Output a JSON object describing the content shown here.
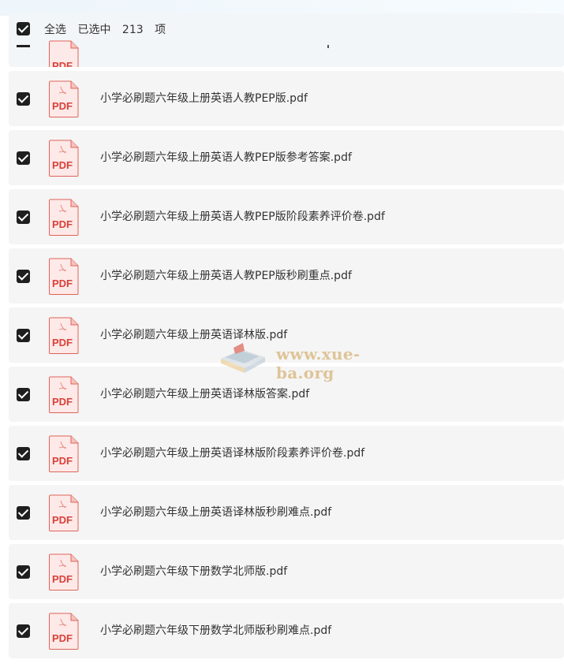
{
  "header": {
    "select_all_label": "全选",
    "selected_prefix": "已选中",
    "selected_count": "213",
    "selected_suffix": "项"
  },
  "file_icon_label": "PDF",
  "watermark_text": "www.xue-ba.org",
  "files": [
    {
      "name": "小学必刷题六年级上册英语人教PEP版.pdf",
      "checked": true
    },
    {
      "name": "小学必刷题六年级上册英语人教PEP版参考答案.pdf",
      "checked": true
    },
    {
      "name": "小学必刷题六年级上册英语人教PEP版阶段素养评价卷.pdf",
      "checked": true
    },
    {
      "name": "小学必刷题六年级上册英语人教PEP版秒刷重点.pdf",
      "checked": true
    },
    {
      "name": "小学必刷题六年级上册英语译林版.pdf",
      "checked": true
    },
    {
      "name": "小学必刷题六年级上册英语译林版答案.pdf",
      "checked": true
    },
    {
      "name": "小学必刷题六年级上册英语译林版阶段素养评价卷.pdf",
      "checked": true
    },
    {
      "name": "小学必刷题六年级上册英语译林版秒刷难点.pdf",
      "checked": true
    },
    {
      "name": "小学必刷题六年级下册数学北师版.pdf",
      "checked": true
    },
    {
      "name": "小学必刷题六年级下册数学北师版秒刷难点.pdf",
      "checked": true
    }
  ],
  "colors": {
    "row_bg": "#f5f5f5",
    "checkbox": "#1f1f1f",
    "pdf_red": "#d9413b",
    "watermark": "#cfa45a"
  }
}
